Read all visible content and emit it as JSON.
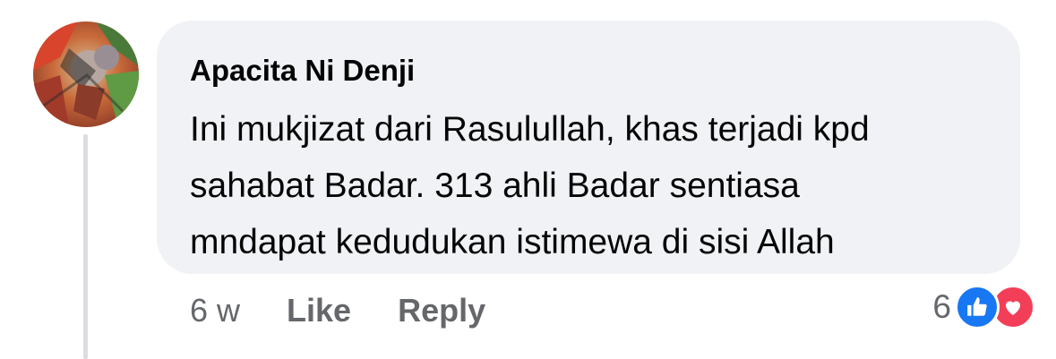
{
  "comment": {
    "author": "Apacita Ni Denji",
    "text_lines": [
      "Ini mukjizat dari Rasulullah, khas terjadi kpd",
      "sahabat Badar. 313 ahli Badar sentiasa",
      "mndapat kedudukan istimewa di sisi Allah"
    ],
    "time": "6 w",
    "like_label": "Like",
    "reply_label": "Reply",
    "reaction_count": "6",
    "reactions": [
      "like-icon",
      "love-icon"
    ]
  },
  "colors": {
    "bubble": "#f0f2f5",
    "text": "#050505",
    "secondary": "#65676b",
    "like": "#1877f2",
    "love": "#f33e58"
  }
}
